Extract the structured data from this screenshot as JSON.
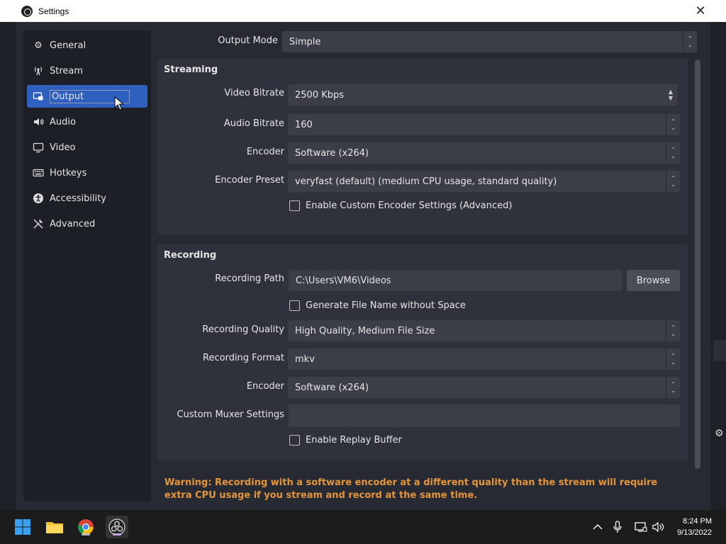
{
  "window": {
    "title": "Settings"
  },
  "sidebar": {
    "items": [
      {
        "label": "General",
        "icon": "gear-icon"
      },
      {
        "label": "Stream",
        "icon": "broadcast-icon"
      },
      {
        "label": "Output",
        "icon": "output-icon",
        "active": true
      },
      {
        "label": "Audio",
        "icon": "speaker-icon"
      },
      {
        "label": "Video",
        "icon": "monitor-icon"
      },
      {
        "label": "Hotkeys",
        "icon": "keyboard-icon"
      },
      {
        "label": "Accessibility",
        "icon": "accessibility-icon"
      },
      {
        "label": "Advanced",
        "icon": "tools-icon"
      }
    ]
  },
  "output_mode": {
    "label": "Output Mode",
    "value": "Simple"
  },
  "streaming": {
    "title": "Streaming",
    "video_bitrate": {
      "label": "Video Bitrate",
      "value": "2500 Kbps"
    },
    "audio_bitrate": {
      "label": "Audio Bitrate",
      "value": "160"
    },
    "encoder": {
      "label": "Encoder",
      "value": "Software (x264)"
    },
    "encoder_preset": {
      "label": "Encoder Preset",
      "value": "veryfast (default) (medium CPU usage, standard quality)"
    },
    "custom_encoder": {
      "label": "Enable Custom Encoder Settings (Advanced)",
      "checked": false
    }
  },
  "recording": {
    "title": "Recording",
    "path": {
      "label": "Recording Path",
      "value": "C:\\Users\\VM6\\Videos"
    },
    "browse_label": "Browse",
    "no_space": {
      "label": "Generate File Name without Space",
      "checked": false
    },
    "quality": {
      "label": "Recording Quality",
      "value": "High Quality, Medium File Size"
    },
    "format": {
      "label": "Recording Format",
      "value": "mkv"
    },
    "encoder": {
      "label": "Encoder",
      "value": "Software (x264)"
    },
    "muxer": {
      "label": "Custom Muxer Settings",
      "value": ""
    },
    "replay_buffer": {
      "label": "Enable Replay Buffer",
      "checked": false
    }
  },
  "warning": "Warning: Recording with a software encoder at a different quality than the stream will require extra CPU usage if you stream and record at the same time.",
  "taskbar": {
    "time": "8:24 PM",
    "date": "9/13/2022"
  },
  "colors": {
    "accent": "#2f5fbf",
    "warning": "#e5953c"
  }
}
